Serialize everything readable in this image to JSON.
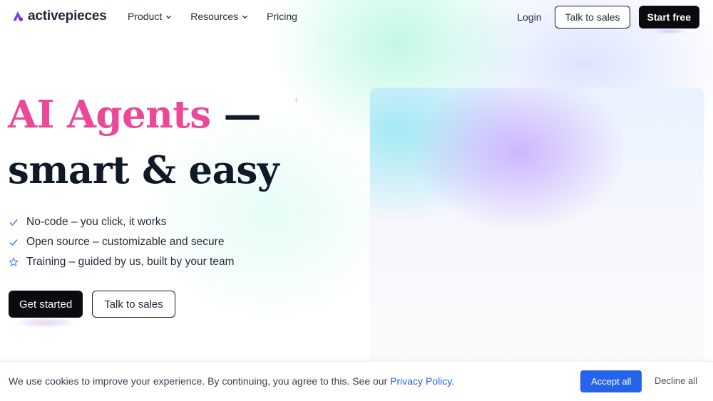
{
  "brand": {
    "name": "activepieces",
    "logo_icon": "activepieces-logo-icon",
    "color": "#6d28d9"
  },
  "nav": {
    "items": [
      {
        "label": "Product",
        "has_dropdown": true
      },
      {
        "label": "Resources",
        "has_dropdown": true
      },
      {
        "label": "Pricing",
        "has_dropdown": false
      }
    ],
    "login": "Login",
    "talk_to_sales": "Talk to sales",
    "start_free": "Start free"
  },
  "hero": {
    "title_accent": "AI Agents",
    "title_dash": " —",
    "title_line2": "smart & easy",
    "features": [
      {
        "icon": "check-icon",
        "text": "No-code – you click, it works"
      },
      {
        "icon": "check-icon",
        "text": "Open source – customizable and secure"
      },
      {
        "icon": "star-icon",
        "text": "Training – guided by us, built by your team"
      }
    ],
    "get_started": "Get started",
    "talk_to_sales": "Talk to sales"
  },
  "cookie": {
    "text": "We use cookies to improve your experience. By continuing, you agree to this. See our ",
    "link": "Privacy Policy",
    "suffix": ".",
    "accept": "Accept all",
    "decline": "Decline all"
  },
  "colors": {
    "accent_pink": "#ec4899",
    "primary_blue": "#2563eb",
    "dark": "#0b0b0f"
  }
}
